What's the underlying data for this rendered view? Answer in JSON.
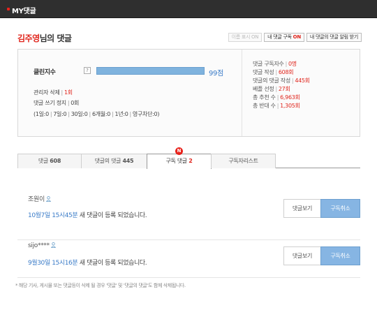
{
  "topbar": {
    "title": "MY댓글"
  },
  "header": {
    "owner_name": "김주영",
    "suffix": "님의 댓글"
  },
  "header_buttons": {
    "name_display": "이름 표시 ON",
    "subscribe_prefix": "내 댓글 구독",
    "subscribe_state": "ON",
    "alerts": "내 댓글의 댓글 알림 받기"
  },
  "clean": {
    "label": "클린지수",
    "help_icon": "?",
    "score": "99점",
    "score_ratio": 0.99,
    "admin_delete_label": "관리자 삭제",
    "admin_delete_value": "1회",
    "write_stop_label": "댓글 쓰기 정지",
    "write_stop_value": "0회",
    "period_summary": "(1일:0",
    "period_7": "7일:0",
    "period_30": "30일:0",
    "period_6m": "6개월:0",
    "period_1y": "1년:0",
    "period_perm": "영구차단:0)"
  },
  "right_stats": [
    {
      "label": "댓글 구독자수",
      "value": "0명"
    },
    {
      "label": "댓글 작성",
      "value": "608회"
    },
    {
      "label": "댓글의 댓글 작성",
      "value": "445회"
    },
    {
      "label": "베플 선정",
      "value": "27회"
    },
    {
      "label": "총 추천 수",
      "value": "6,963회"
    },
    {
      "label": "총 반대 수",
      "value": "1,305회"
    }
  ],
  "tabs": [
    {
      "label": "댓글",
      "count": "608"
    },
    {
      "label": "댓글의 댓글",
      "count": "445"
    },
    {
      "label": "구독 댓글",
      "count": "2"
    },
    {
      "label": "구독자리스트",
      "count": ""
    }
  ],
  "new_badge": "N",
  "notices": [
    {
      "user": "조원이",
      "user_icon": "person-icon",
      "time": "10월7일 15시45분",
      "message": " 새 댓글이 등록 되었습니다.",
      "view_label": "댓글보기",
      "unsub_label": "구독취소"
    },
    {
      "user": "sijo****",
      "user_icon": "person-icon",
      "time": "9월30일 15시16분",
      "message": " 새 댓글이 등록 되었습니다.",
      "view_label": "댓글보기",
      "unsub_label": "구독취소"
    }
  ],
  "footnote": "* 해당 기사, 게시물 또는 댓글등이 삭제 될 경우 '댓글' 및 '댓글의 댓글'도 함께 삭제됩니다.",
  "colors": {
    "accent_red": "#e0251c",
    "link_blue": "#3b7cc8",
    "bar_blue": "#7fb3de",
    "unsubscribe_blue": "#86b5e3"
  }
}
